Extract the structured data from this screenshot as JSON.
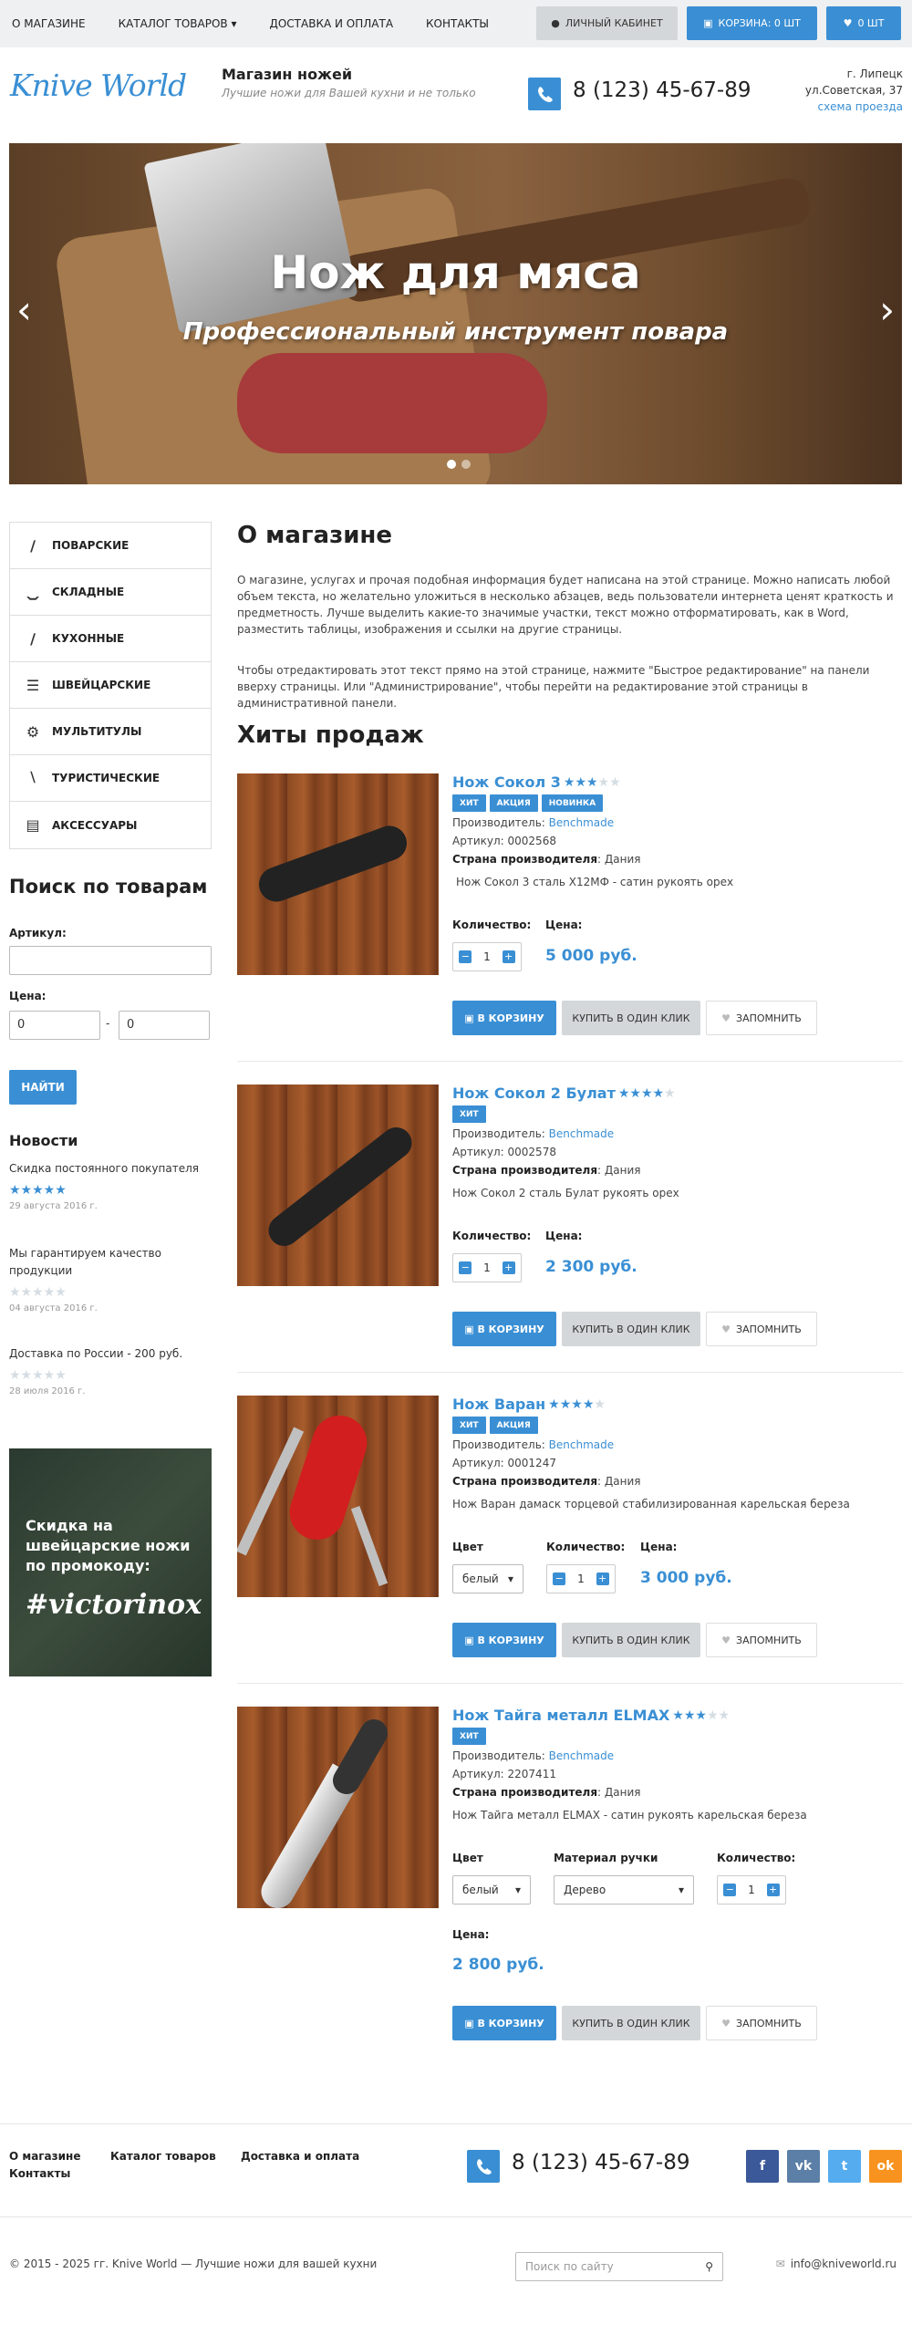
{
  "topnav": {
    "items": [
      "О магазине",
      "Каталог товаров",
      "Доставка и оплата",
      "Контакты"
    ],
    "catalog_arrow": "▾",
    "account": "Личный кабинет",
    "cart": "Корзина: 0 шт",
    "favorites": "0 шт"
  },
  "header": {
    "logo": "Knive World",
    "shop_name": "Магазин ножей",
    "slogan": "Лучшие ножи для Вашей кухни и не только",
    "phone": "8 (123) 45-67-89",
    "city": "г. Липецк",
    "street": "ул.Советская, 37",
    "map_link": "схема проезда"
  },
  "slider": {
    "title": "Нож для мяса",
    "subtitle": "Профессиональный инструмент повара",
    "prev": "‹",
    "next": "›"
  },
  "categories": [
    {
      "label": "Поварские",
      "icon": "chef-knife-icon"
    },
    {
      "label": "Складные",
      "icon": "folding-knife-icon"
    },
    {
      "label": "Кухонные",
      "icon": "kitchen-knife-icon"
    },
    {
      "label": "Швейцарские",
      "icon": "swiss-knife-icon"
    },
    {
      "label": "Мультитулы",
      "icon": "multitool-icon"
    },
    {
      "label": "Туристические",
      "icon": "hunting-knife-icon"
    },
    {
      "label": "Аксессуары",
      "icon": "accessories-icon"
    }
  ],
  "search": {
    "title": "Поиск по товарам",
    "article_label": "Артикул:",
    "article_value": "",
    "price_label": "Цена:",
    "price_from": "0",
    "price_dash": "-",
    "price_to": "0",
    "button": "Найти"
  },
  "news": {
    "title": "Новости",
    "items": [
      {
        "text": "Скидка постоянного покупателя",
        "rating": 5,
        "date": "29 августа 2016 г."
      },
      {
        "text": "Мы гарантируем качество продукции",
        "rating": 0,
        "date": "04 августа 2016 г."
      },
      {
        "text": "Доставка по России - 200 руб.",
        "rating": 0,
        "date": "28 июля 2016 г."
      }
    ]
  },
  "promo": {
    "text": "Скидка на швейцарские ножи по промокоду:",
    "code": "#victorinox"
  },
  "about": {
    "title": "О магазине",
    "p1": "О магазине, услугах и прочая подобная информация будет написана на этой странице. Можно написать любой объем текста, но желательно уложиться в несколько абзацев, ведь пользователи интернета ценят краткость и предметность. Лучше выделить какие-то значимые участки, текст можно отформатировать, как в Word, разместить таблицы, изображения и ссылки на другие страницы.",
    "p2": "Чтобы отредактировать этот текст прямо на этой странице, нажмите \"Быстрое редактирование\" на панели вверху страницы. Или \"Администрирование\", чтобы перейти на редактирование этой страницы в административной панели."
  },
  "hits": {
    "title": "Хиты продаж",
    "labels": {
      "maker": "Производитель:",
      "article": "Артикул:",
      "country": "Страна производителя",
      "qty": "Количество:",
      "price": "Цена:",
      "color": "Цвет",
      "handle": "Материал ручки",
      "to_cart": "В корзину",
      "one_click": "Купить в один клик",
      "remember": "Запомнить"
    },
    "products": [
      {
        "name": "Нож Сокол 3",
        "rating": 3,
        "badges": [
          "Хит",
          "Акция",
          "Новинка"
        ],
        "maker": "Benchmade",
        "article": "0002568",
        "country": "Дания",
        "desc": "Нож Сокол 3 сталь Х12МФ - сатин рукоять орех",
        "qty": "1",
        "price": "5 000 руб."
      },
      {
        "name": "Нож Сокол 2 Булат",
        "rating": 4,
        "badges": [
          "Хит"
        ],
        "maker": "Benchmade",
        "article": "0002578",
        "country": "Дания",
        "desc": "Нож Сокол 2 сталь Булат рукоять орех",
        "qty": "1",
        "price": "2 300 руб."
      },
      {
        "name": "Нож Варан",
        "rating": 4,
        "badges": [
          "Хит",
          "Акция"
        ],
        "maker": "Benchmade",
        "article": "0001247",
        "country": "Дания",
        "desc": "Нож Варан дамаск торцевой стабилизированная карельская береза",
        "color": "белый",
        "qty": "1",
        "price": "3 000 руб."
      },
      {
        "name": "Нож Тайга металл ELMAX",
        "rating": 3,
        "badges": [
          "Хит"
        ],
        "maker": "Benchmade",
        "article": "2207411",
        "country": "Дания",
        "desc": "Нож Тайга металл ELMAX - сатин рукоять карельская береза",
        "color": "белый",
        "handle": "Дерево",
        "qty": "1",
        "price": "2 800 руб."
      }
    ]
  },
  "footer": {
    "nav": [
      "О магазине",
      "Каталог товаров",
      "Доставка и оплата",
      "Контакты"
    ],
    "phone": "8 (123) 45-67-89",
    "social": [
      {
        "name": "facebook",
        "glyph": "f",
        "color": "#3b5998"
      },
      {
        "name": "vk",
        "glyph": "vk",
        "color": "#5b7fa6"
      },
      {
        "name": "twitter",
        "glyph": "t",
        "color": "#55acee"
      },
      {
        "name": "odnoklassniki",
        "glyph": "ok",
        "color": "#f7931e"
      }
    ],
    "copyright": "© 2015 - 2025 гг. Knive World — Лучшие ножи для вашей кухни",
    "search_placeholder": "Поиск по сайту",
    "email": "info@kniveworld.ru"
  },
  "colors": {
    "accent": "#3a8fd4",
    "topbar": "#eef0f1",
    "button_gray": "#d4d7d9"
  }
}
